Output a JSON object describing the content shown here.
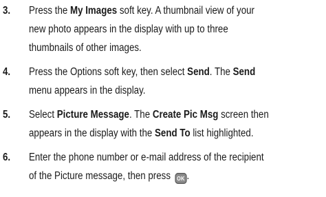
{
  "steps": [
    {
      "number": "3.",
      "lines": [
        [
          {
            "t": "Press the "
          },
          {
            "t": "My Images",
            "b": true
          },
          {
            "t": " soft key. A thumbnail view of your"
          }
        ],
        [
          {
            "t": "new photo appears in the display with up to three"
          }
        ],
        [
          {
            "t": "thumbnails of other images."
          }
        ]
      ]
    },
    {
      "number": "4.",
      "lines": [
        [
          {
            "t": "Press the Options soft key, then select "
          },
          {
            "t": "Send",
            "b": true
          },
          {
            "t": ". The "
          },
          {
            "t": "Send",
            "b": true
          }
        ],
        [
          {
            "t": "menu appears in the display."
          }
        ]
      ]
    },
    {
      "number": "5.",
      "lines": [
        [
          {
            "t": "Select "
          },
          {
            "t": "Picture Message",
            "b": true
          },
          {
            "t": ". The "
          },
          {
            "t": "Create Pic Msg",
            "b": true
          },
          {
            "t": " screen then"
          }
        ],
        [
          {
            "t": "appears in the display with the "
          },
          {
            "t": "Send To",
            "b": true
          },
          {
            "t": " list highlighted."
          }
        ]
      ]
    },
    {
      "number": "6.",
      "lines": [
        [
          {
            "t": "Enter the phone number or e-mail address of the recipient"
          }
        ],
        [
          {
            "t": "of the Picture message, then press "
          },
          {
            "icon": "ok-key-icon",
            "label": "OK"
          },
          {
            "t": "."
          }
        ]
      ]
    }
  ]
}
